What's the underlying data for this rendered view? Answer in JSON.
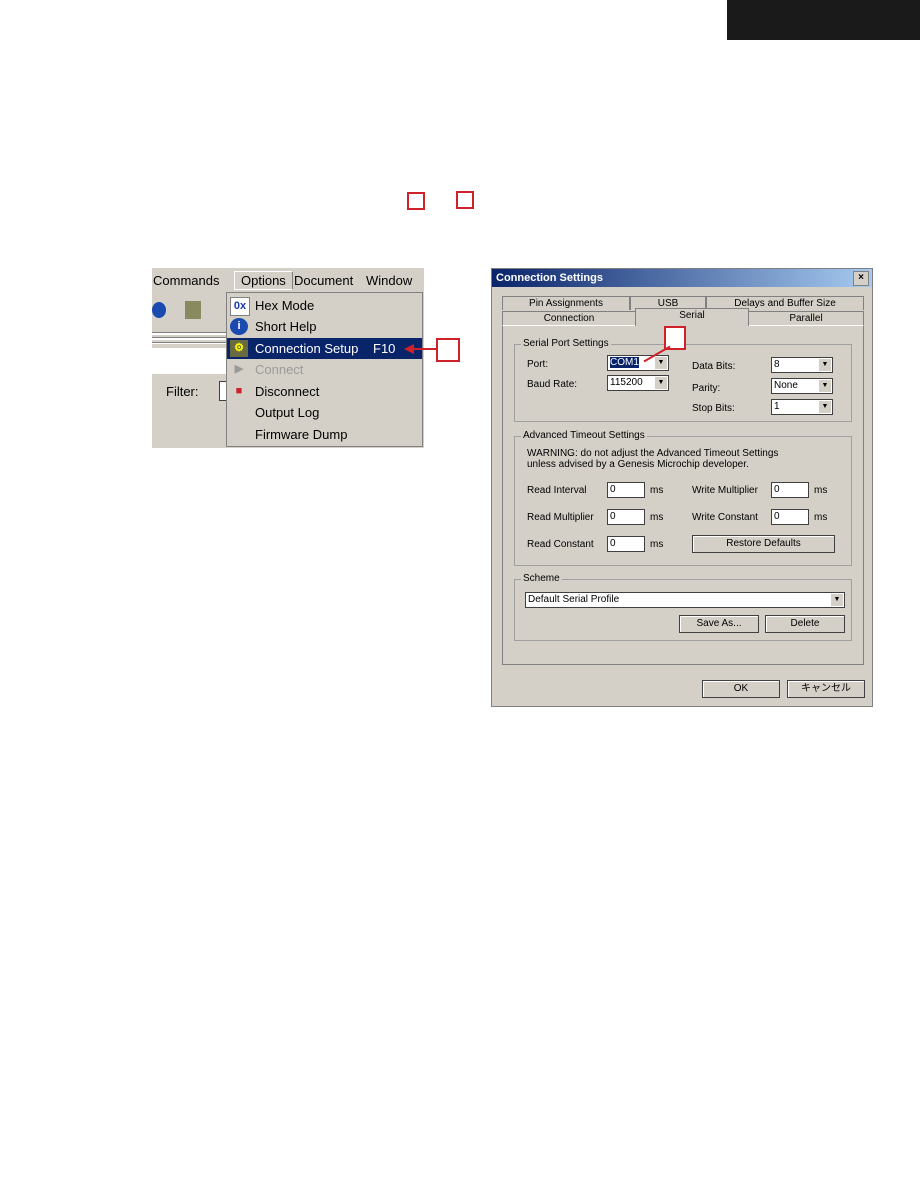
{
  "menu": {
    "bar": [
      "Commands",
      "Options",
      "Document",
      "Window"
    ],
    "filter_label": "Filter:",
    "items": [
      {
        "label": "Hex Mode",
        "icon": "hex-icon",
        "glyph": "0x"
      },
      {
        "label": "Short Help",
        "icon": "info-icon",
        "glyph": "i"
      },
      {
        "label": "Connection Setup",
        "shortcut": "F10",
        "icon": "connection-setup-icon",
        "glyph": "⚙",
        "selected": true
      },
      {
        "label": "Connect",
        "icon": "connect-plug-icon",
        "glyph": "▶",
        "disabled": true
      },
      {
        "label": "Disconnect",
        "icon": "disconnect-icon",
        "glyph": "■"
      },
      {
        "label": "Output Log"
      },
      {
        "label": "Firmware Dump"
      }
    ]
  },
  "dialog": {
    "title": "Connection Settings",
    "close": "×",
    "tabs_back": [
      "Pin Assignments",
      "USB",
      "Delays and Buffer Size"
    ],
    "tabs_front": [
      "Connection",
      "Serial",
      "Parallel"
    ],
    "serial": {
      "group": "Serial Port Settings",
      "port_label": "Port:",
      "port": "COM1",
      "baud_label": "Baud Rate:",
      "baud": "115200",
      "data_bits_label": "Data Bits:",
      "data_bits": "8",
      "parity_label": "Parity:",
      "parity": "None",
      "stop_bits_label": "Stop Bits:",
      "stop_bits": "1"
    },
    "timeout": {
      "group": "Advanced Timeout Settings",
      "warning1": "WARNING: do not adjust the Advanced Timeout Settings",
      "warning2": "unless advised by a Genesis Microchip developer.",
      "read_interval_label": "Read Interval",
      "read_interval": "0",
      "read_mult_label": "Read Multiplier",
      "read_mult": "0",
      "read_const_label": "Read Constant",
      "read_const": "0",
      "write_mult_label": "Write Multiplier",
      "write_mult": "0",
      "write_const_label": "Write Constant",
      "write_const": "0",
      "unit": "ms",
      "restore": "Restore Defaults"
    },
    "scheme": {
      "group": "Scheme",
      "value": "Default Serial Profile",
      "save_as": "Save As...",
      "delete": "Delete"
    },
    "ok": "OK",
    "cancel": "キャンセル"
  },
  "colors": {
    "annotation_red": "#d0202a",
    "selection": "#0a246a"
  }
}
